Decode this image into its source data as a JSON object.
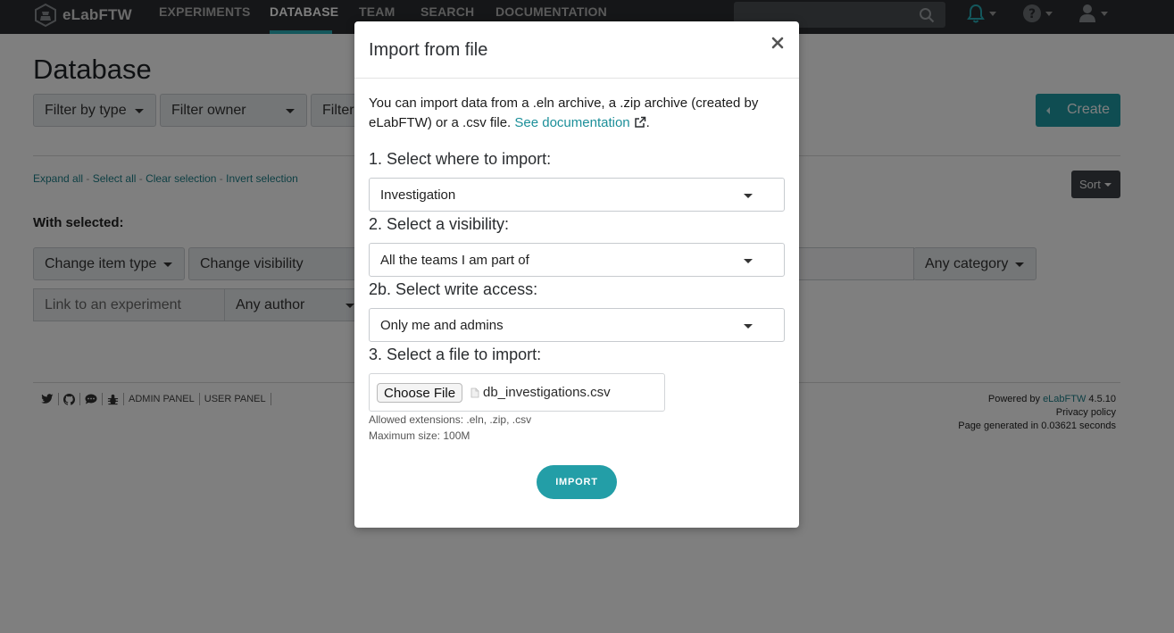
{
  "nav": {
    "brand": "eLabFTW",
    "links": [
      "EXPERIMENTS",
      "DATABASE",
      "TEAM",
      "SEARCH",
      "DOCUMENTATION"
    ],
    "active": "DATABASE",
    "search_placeholder": ""
  },
  "page": {
    "title": "Database",
    "filters": [
      "Filter by type",
      "Filter owner",
      "Filter"
    ],
    "create_label": "Create",
    "selection_links": [
      "Expand all",
      "Select all",
      "Clear selection",
      "Invert selection"
    ],
    "sort_label": "Sort",
    "with_selected": "With selected:",
    "change_item_type": "Change item type",
    "change_visibility": "Change visibility",
    "any_category": "Any category",
    "link_to_experiment": "Link to an experiment",
    "any_author": "Any author"
  },
  "footer": {
    "admin_panel": "ADMIN PANEL",
    "user_panel": "USER PANEL",
    "powered_by": "Powered by ",
    "powered_by_link": "eLabFTW",
    "version": " 4.5.10",
    "privacy": "Privacy policy",
    "generated": "Page generated in 0.03621 seconds"
  },
  "modal": {
    "title": "Import from file",
    "intro": "You can import data from a .eln archive, a .zip archive (created by eLabFTW) or a .csv file. ",
    "doc_link": "See documentation",
    "period": ".",
    "step1_label": "1. Select where to import:",
    "step1_value": "Investigation",
    "step2_label": "2. Select a visibility:",
    "step2_value": "All the teams I am part of",
    "step2b_label": "2b. Select write access:",
    "step2b_value": "Only me and admins",
    "step3_label": "3. Select a file to import:",
    "choose_file": "Choose File",
    "file_name": "db_investigations.csv",
    "allowed_ext": "Allowed extensions: .eln, .zip, .csv",
    "max_size": "Maximum size: 100M",
    "import_label": "IMPORT"
  },
  "colors": {
    "accent": "#29aeb9",
    "nav_bg": "#2a2d30",
    "overlay": "rgba(0,0,0,0.5)"
  }
}
